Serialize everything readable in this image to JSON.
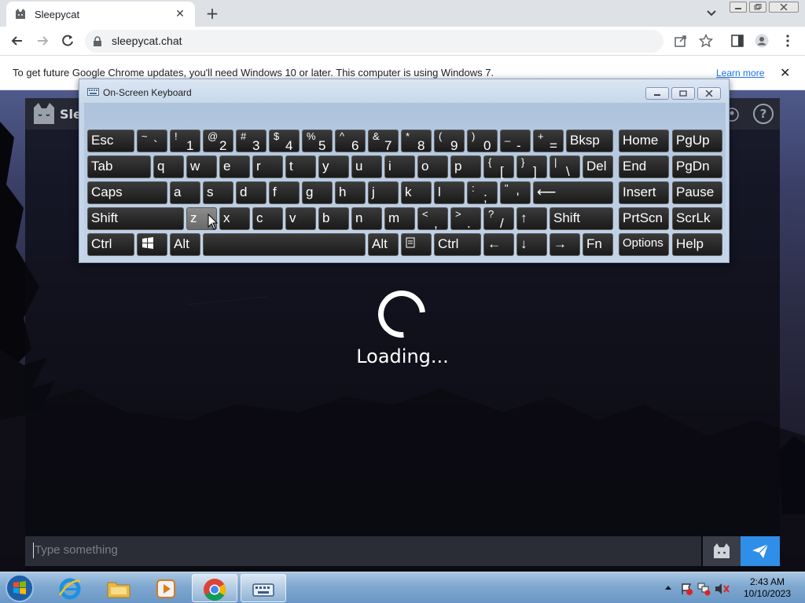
{
  "browser": {
    "tab_title": "Sleepycat",
    "url": "sleepycat.chat",
    "infobar_message": "To get future Google Chrome updates, you'll need Windows 10 or later. This computer is using Windows 7.",
    "infobar_link": "Learn more"
  },
  "app": {
    "name": "Slee",
    "help_label": "?",
    "loading_text": "Loading...",
    "chat_placeholder": "Type something"
  },
  "osk": {
    "title": "On-Screen Keyboard",
    "rows": [
      [
        {
          "label": "Esc"
        },
        {
          "shift": "~",
          "base": "`"
        },
        {
          "shift": "!",
          "base": "1"
        },
        {
          "shift": "@",
          "base": "2"
        },
        {
          "shift": "#",
          "base": "3"
        },
        {
          "shift": "$",
          "base": "4"
        },
        {
          "shift": "%",
          "base": "5"
        },
        {
          "shift": "^",
          "base": "6"
        },
        {
          "shift": "&",
          "base": "7"
        },
        {
          "shift": "*",
          "base": "8"
        },
        {
          "shift": "(",
          "base": "9"
        },
        {
          "shift": ")",
          "base": "0"
        },
        {
          "shift": "_",
          "base": "-"
        },
        {
          "shift": "+",
          "base": "="
        },
        {
          "label": "Bksp"
        },
        {
          "label": "Home"
        },
        {
          "label": "PgUp"
        }
      ],
      [
        {
          "label": "Tab"
        },
        {
          "label": "q"
        },
        {
          "label": "w"
        },
        {
          "label": "e"
        },
        {
          "label": "r"
        },
        {
          "label": "t"
        },
        {
          "label": "y"
        },
        {
          "label": "u"
        },
        {
          "label": "i"
        },
        {
          "label": "o"
        },
        {
          "label": "p"
        },
        {
          "shift": "{",
          "base": "["
        },
        {
          "shift": "}",
          "base": "]"
        },
        {
          "shift": "|",
          "base": "\\"
        },
        {
          "label": "Del"
        },
        {
          "label": "End"
        },
        {
          "label": "PgDn"
        }
      ],
      [
        {
          "label": "Caps"
        },
        {
          "label": "a"
        },
        {
          "label": "s"
        },
        {
          "label": "d"
        },
        {
          "label": "f"
        },
        {
          "label": "g"
        },
        {
          "label": "h"
        },
        {
          "label": "j"
        },
        {
          "label": "k"
        },
        {
          "label": "l"
        },
        {
          "shift": ":",
          "base": ";"
        },
        {
          "shift": "\"",
          "base": "'"
        },
        {
          "label": "⟵"
        },
        {
          "label": "Insert"
        },
        {
          "label": "Pause"
        }
      ],
      [
        {
          "label": "Shift"
        },
        {
          "label": "z"
        },
        {
          "label": "x"
        },
        {
          "label": "c"
        },
        {
          "label": "v"
        },
        {
          "label": "b"
        },
        {
          "label": "n"
        },
        {
          "label": "m"
        },
        {
          "shift": "<",
          "base": ","
        },
        {
          "shift": ">",
          "base": "."
        },
        {
          "shift": "?",
          "base": "/"
        },
        {
          "label": "↑"
        },
        {
          "label": "Shift"
        },
        {
          "label": "PrtScn"
        },
        {
          "label": "ScrLk"
        }
      ],
      [
        {
          "label": "Ctrl"
        },
        {
          "label": ""
        },
        {
          "label": "Alt"
        },
        {
          "label": ""
        },
        {
          "label": "Alt"
        },
        {
          "label": ""
        },
        {
          "label": "Ctrl"
        },
        {
          "label": "←"
        },
        {
          "label": "↓"
        },
        {
          "label": "→"
        },
        {
          "label": "Fn"
        },
        {
          "label": "Options"
        },
        {
          "label": "Help"
        }
      ]
    ]
  },
  "taskbar": {
    "time": "2:43 AM",
    "date": "10/10/2023"
  }
}
